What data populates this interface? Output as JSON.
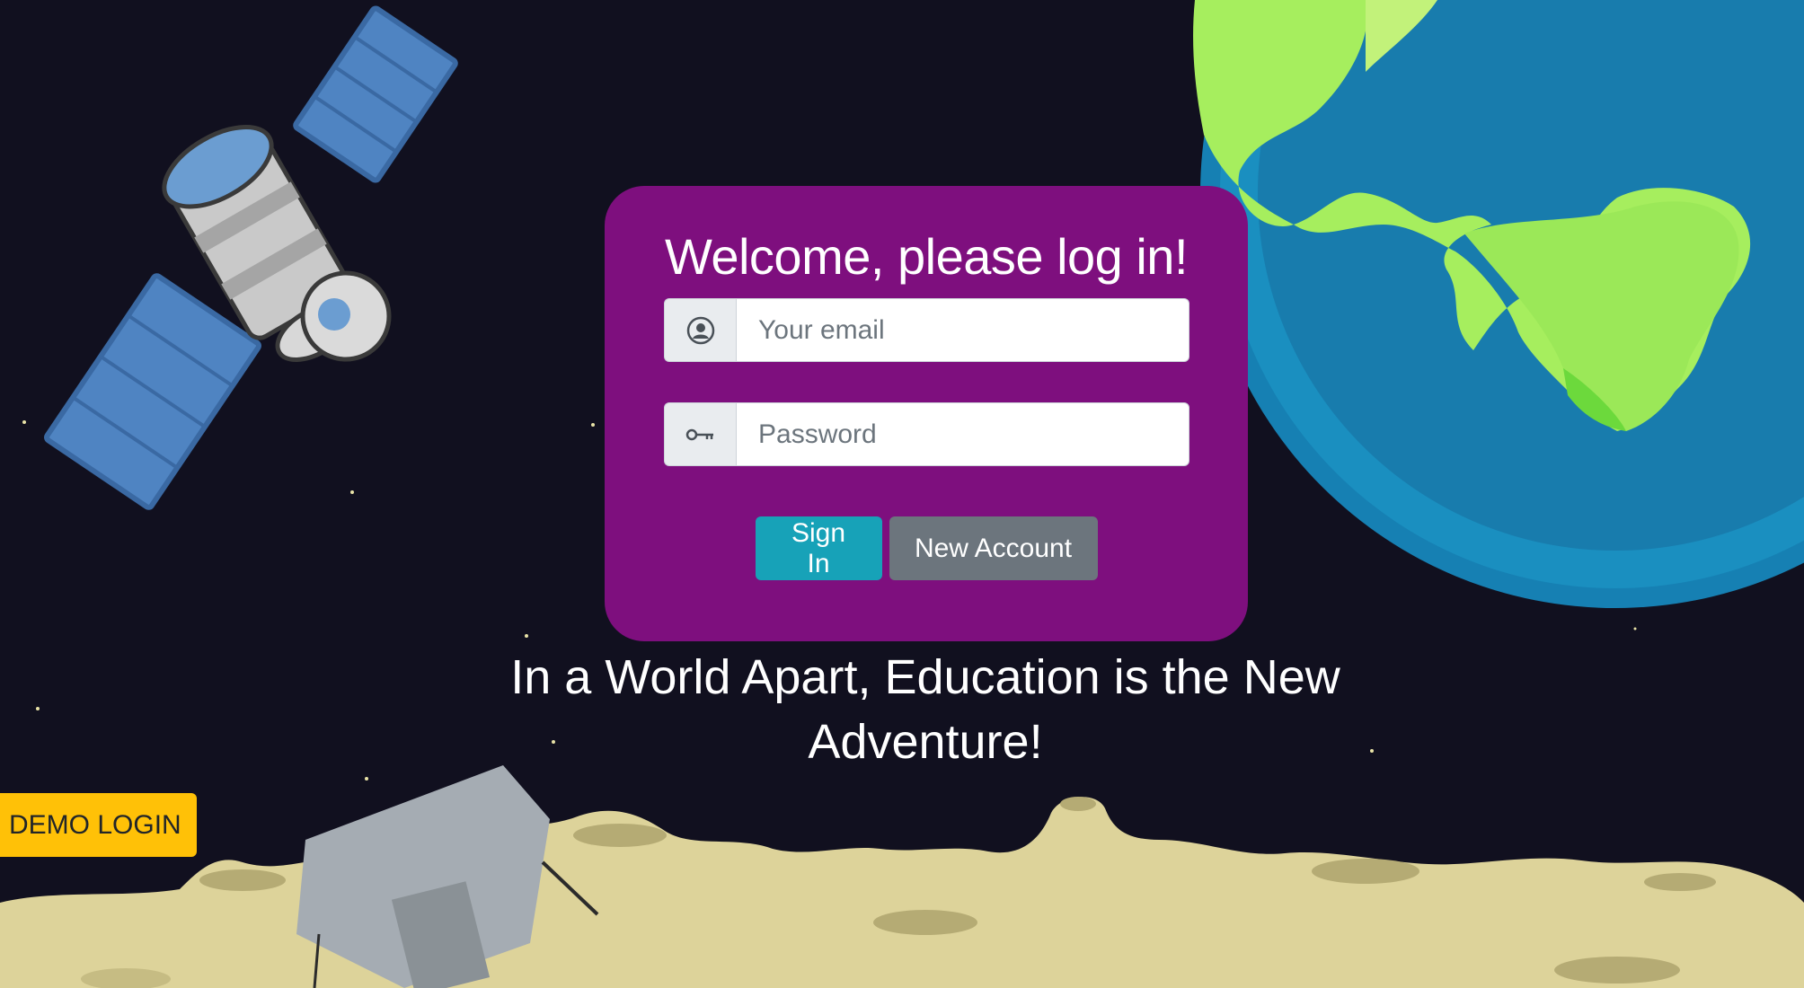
{
  "login": {
    "title": "Welcome, please log in!",
    "email_placeholder": "Your email",
    "password_placeholder": "Password",
    "email_icon": "user-circle-icon",
    "password_icon": "key-icon",
    "signin_label": "Sign In",
    "new_account_label": "New Account"
  },
  "tagline": "In a World Apart, Education is the New Adventure!",
  "demo_login_label": "DEMO LOGIN",
  "colors": {
    "background": "#11101f",
    "card": "#7e0f7e",
    "signin": "#17a2b8",
    "new_account": "#6c757d",
    "demo": "#ffc107",
    "moon": "#ddd39a",
    "earth_ocean": "#1676a8",
    "earth_land": "#a6ee5e"
  }
}
